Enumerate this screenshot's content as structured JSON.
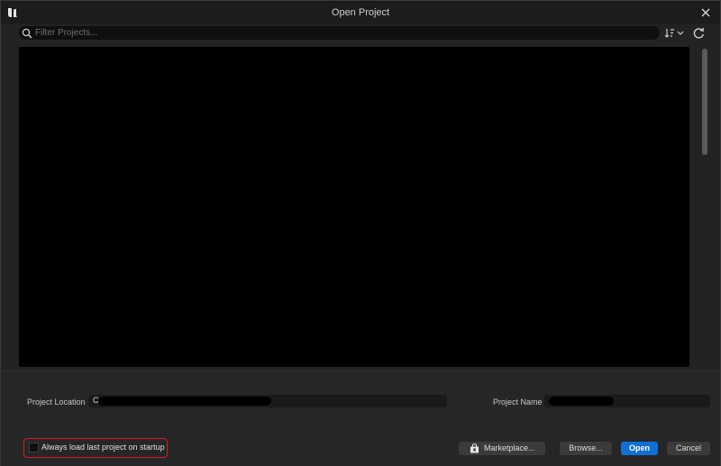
{
  "window": {
    "title": "Open Project"
  },
  "search": {
    "placeholder": "Filter Projects..."
  },
  "fields": {
    "location_label": "Project Location",
    "location_value": "C",
    "name_label": "Project Name",
    "name_value": ""
  },
  "options": {
    "always_load_label": "Always load last project on startup",
    "always_load_checked": false
  },
  "buttons": {
    "marketplace": "Marketplace...",
    "browse": "Browse...",
    "open": "Open",
    "cancel": "Cancel"
  },
  "icons": {
    "logo": "unreal-engine-logo-icon",
    "close": "close-icon",
    "search": "search-icon",
    "sort": "sort-icon",
    "refresh": "refresh-icon",
    "marketplace": "marketplace-bag-icon"
  },
  "colors": {
    "accent": "#0f6fd6",
    "highlight_border": "#d21f1f",
    "background": "#232323"
  }
}
